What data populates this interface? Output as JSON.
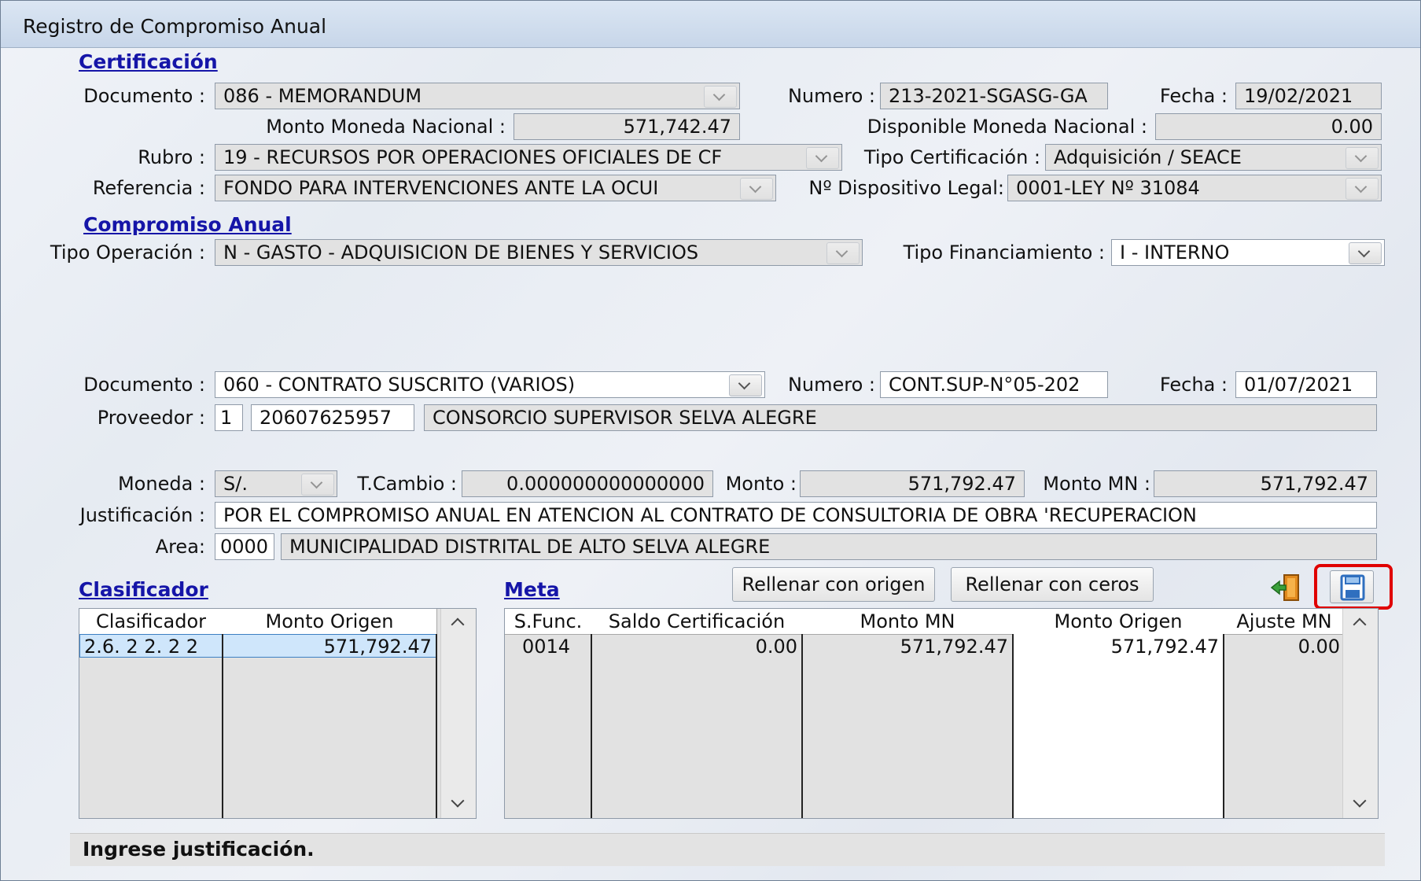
{
  "window": {
    "title": "Registro de Compromiso Anual"
  },
  "certificacion": {
    "section_title": "Certificación",
    "documento_label": "Documento :",
    "documento_value": "086 - MEMORANDUM",
    "numero_label": "Numero :",
    "numero_value": "213-2021-SGASG-GA",
    "fecha_label": "Fecha :",
    "fecha_value": "19/02/2021",
    "monto_mn_label": "Monto Moneda Nacional :",
    "monto_mn_value": "571,742.47",
    "disponible_label": "Disponible Moneda Nacional :",
    "disponible_value": "0.00",
    "rubro_label": "Rubro :",
    "rubro_value": "19 - RECURSOS POR OPERACIONES OFICIALES DE CF",
    "tipo_cert_label": "Tipo Certificación :",
    "tipo_cert_value": "Adquisición / SEACE",
    "referencia_label": "Referencia :",
    "referencia_value": "FONDO PARA INTERVENCIONES ANTE LA OCUI",
    "dispositivo_label": "Nº Dispositivo Legal:",
    "dispositivo_value": "0001-LEY Nº 31084"
  },
  "compromiso": {
    "section_title": "Compromiso Anual",
    "tipo_operacion_label": "Tipo Operación :",
    "tipo_operacion_value": "N  - GASTO - ADQUISICION DE BIENES Y SERVICIOS",
    "tipo_financiamiento_label": "Tipo Financiamiento :",
    "tipo_financiamiento_value": "I - INTERNO",
    "documento_label": "Documento :",
    "documento_value": "060 - CONTRATO SUSCRITO (VARIOS)",
    "numero_label": "Numero :",
    "numero_value": "CONT.SUP-N°05-202",
    "fecha_label": "Fecha :",
    "fecha_value": "01/07/2021",
    "proveedor_label": "Proveedor :",
    "proveedor_tipo": "1",
    "proveedor_ruc": "20607625957",
    "proveedor_nombre": "CONSORCIO SUPERVISOR SELVA ALEGRE",
    "moneda_label": "Moneda :",
    "moneda_value": "S/.",
    "tcambio_label": "T.Cambio :",
    "tcambio_value": "0.000000000000000",
    "monto_label": "Monto :",
    "monto_value": "571,792.47",
    "monto_mn_label": "Monto MN :",
    "monto_mn_value": "571,792.47",
    "justificacion_label": "Justificación :",
    "justificacion_value": "POR EL COMPROMISO ANUAL EN ATENCION AL CONTRATO DE CONSULTORIA DE OBRA 'RECUPERACION",
    "area_label": "Area:",
    "area_code": "0000",
    "area_name": "MUNICIPALIDAD DISTRITAL DE ALTO SELVA ALEGRE"
  },
  "clasificador": {
    "section_title": "Clasificador",
    "columns": [
      "Clasificador",
      "Monto Origen"
    ],
    "rows": [
      [
        "2.6. 2 2. 2 2",
        "571,792.47"
      ]
    ]
  },
  "meta": {
    "section_title": "Meta",
    "columns": [
      "S.Func.",
      "Saldo Certificación",
      "Monto MN",
      "Monto Origen",
      "Ajuste MN"
    ],
    "rows": [
      [
        "0014",
        "0.00",
        "571,792.47",
        "571,792.47",
        "0.00"
      ]
    ]
  },
  "buttons": {
    "rellenar_origen": "Rellenar con origen",
    "rellenar_ceros": "Rellenar con ceros"
  },
  "status": {
    "message": "Ingrese justificación."
  },
  "colors": {
    "section_link": "#1515a8",
    "highlight": "#e00000",
    "selection": "#cfe6fb"
  },
  "icons": {
    "exit": "exit-door-icon",
    "save": "save-disk-icon"
  }
}
